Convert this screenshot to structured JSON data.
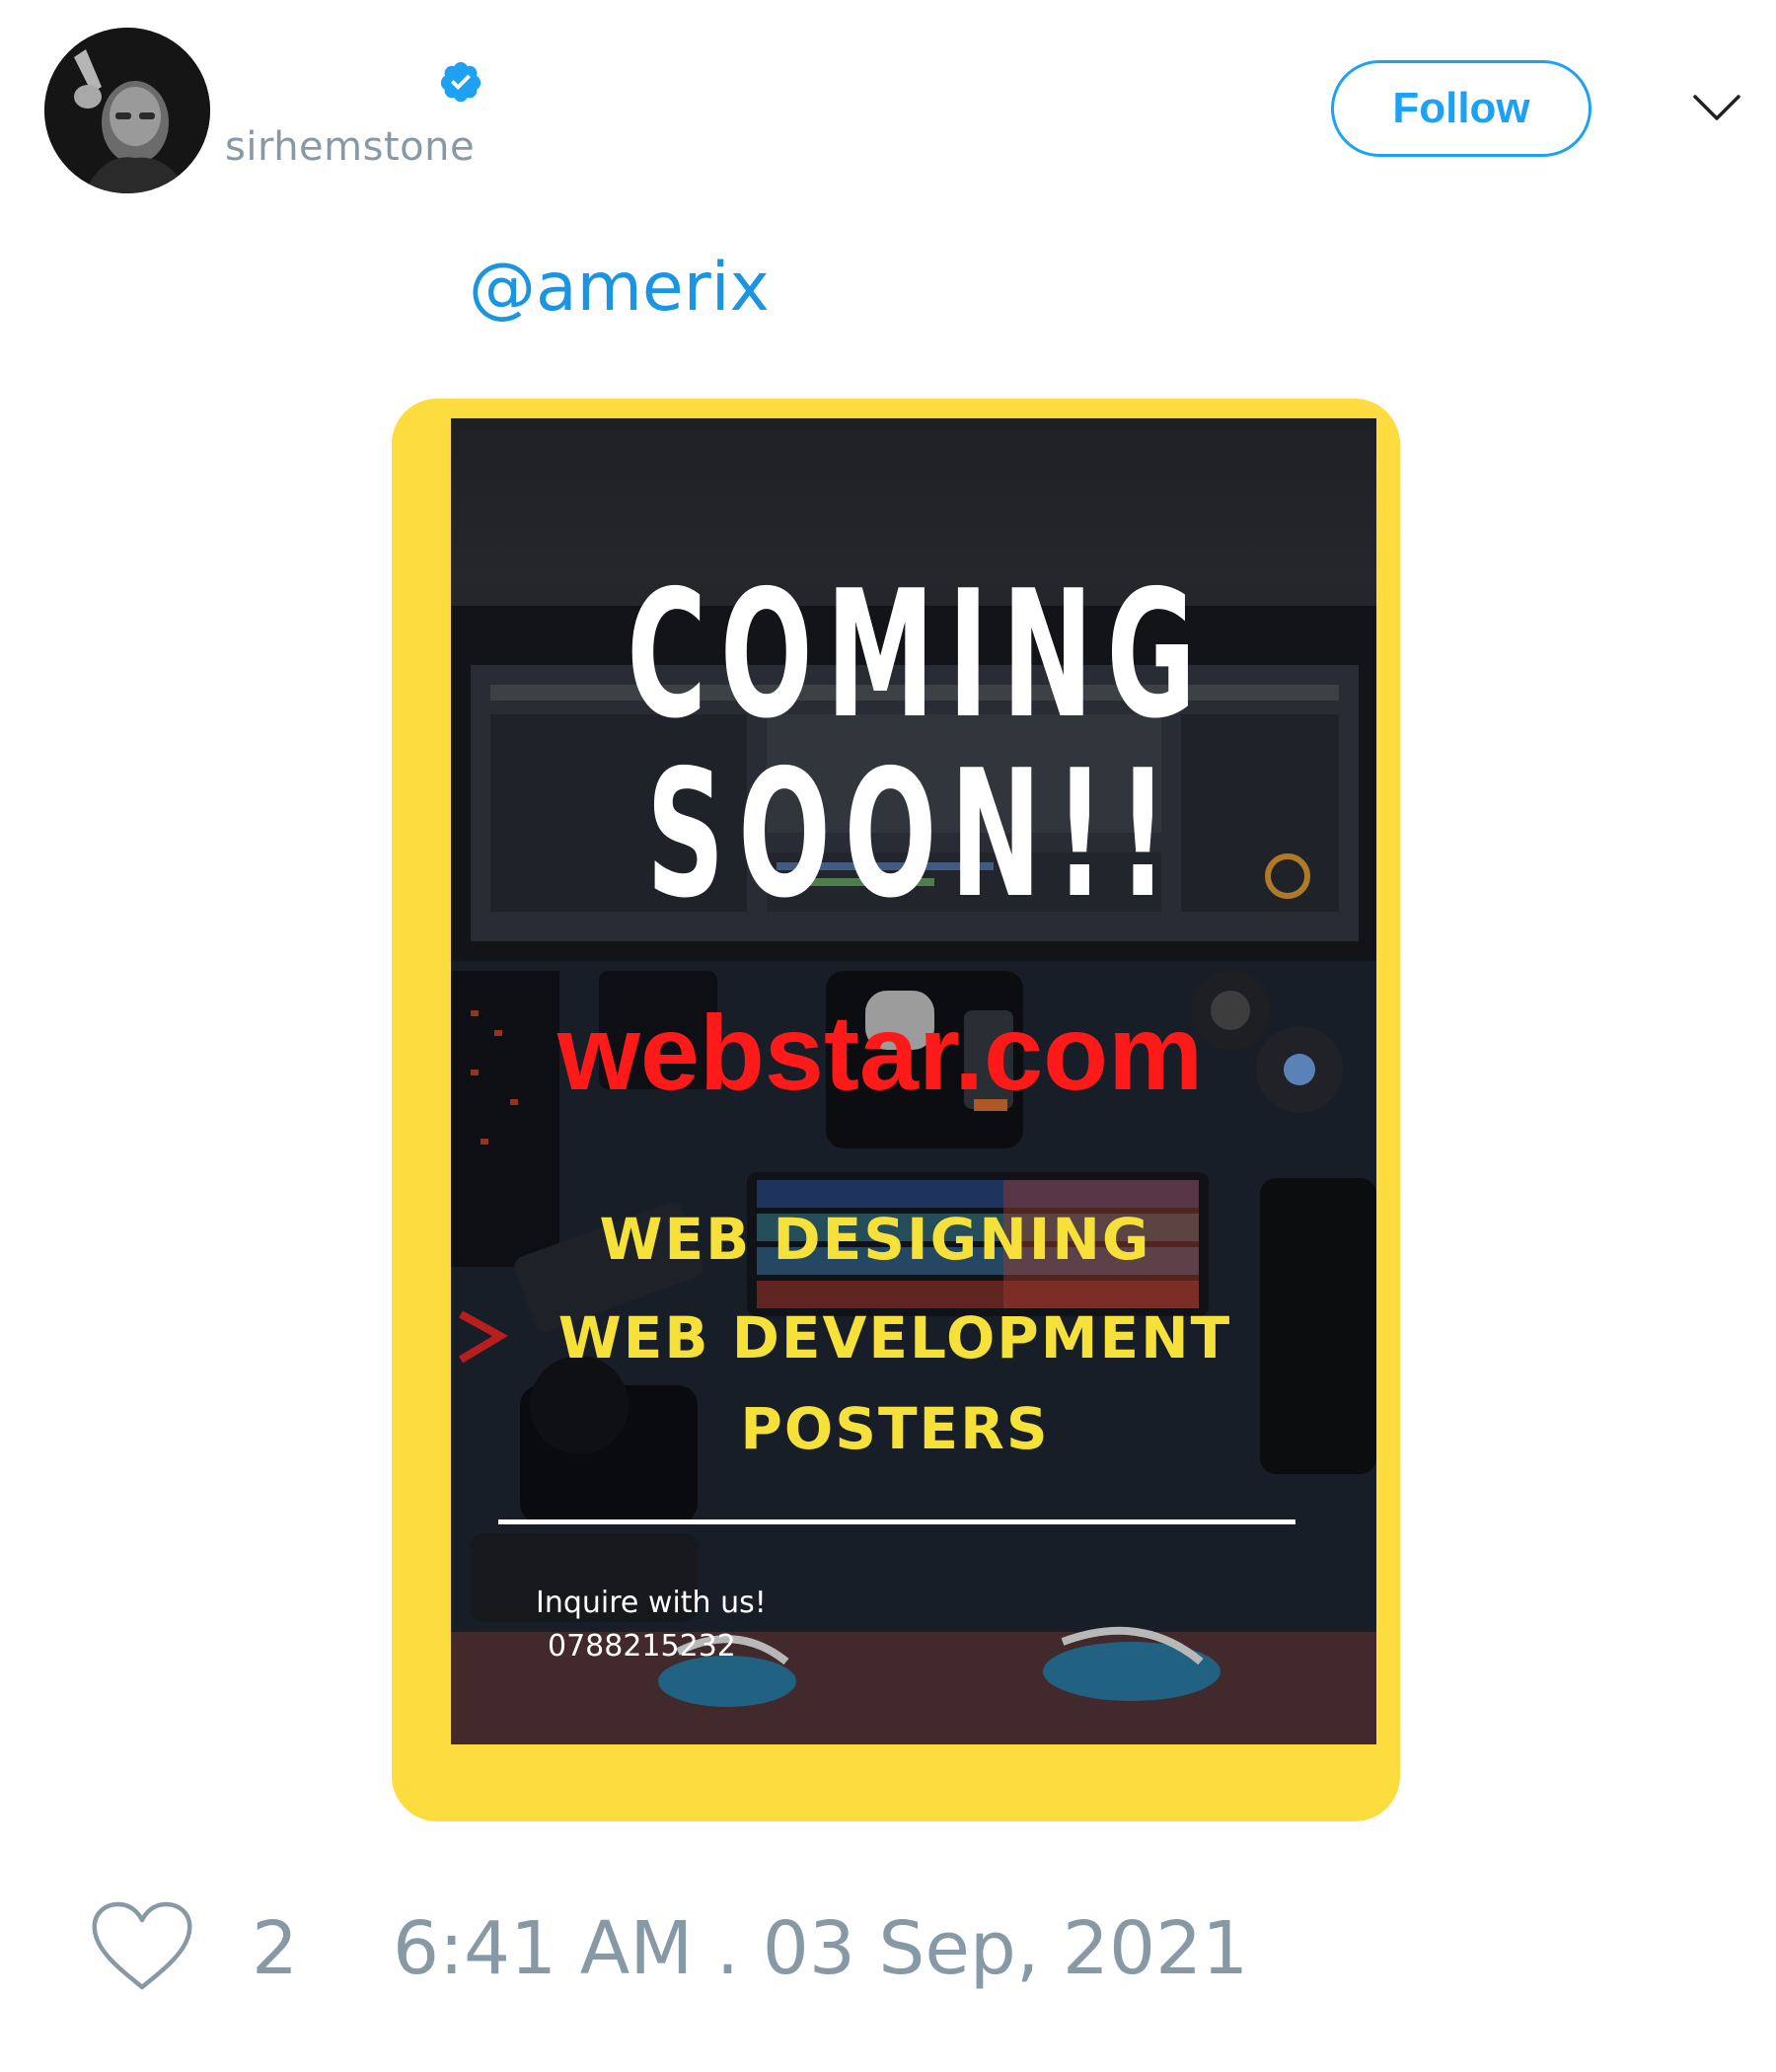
{
  "user": {
    "handle": "sirhemstone",
    "verified_icon": "verified-badge-icon",
    "avatar_icon": "avatar"
  },
  "header": {
    "follow_label": "Follow",
    "menu_icon": "chevron-down-icon"
  },
  "tweet": {
    "mention": "@amerix"
  },
  "poster": {
    "headline_line1": "COMING",
    "headline_line2": "SOON!!",
    "brand": "webstar.com",
    "services": [
      "WEB DESIGNING",
      "WEB DEVELOPMENT",
      "POSTERS"
    ],
    "inquire": "Inquire with us!",
    "phone": "0788215232"
  },
  "footer": {
    "like_icon": "heart-icon",
    "like_count": "2",
    "timestamp": "6:41 AM . 03 Sep, 2021"
  },
  "colors": {
    "accent": "#1da1f2",
    "mention": "#1b95e0",
    "muted": "#8899a6",
    "poster_frame": "#fcdc3f",
    "brand_red": "#ff1a1a",
    "service_yellow": "#f6e03a"
  }
}
